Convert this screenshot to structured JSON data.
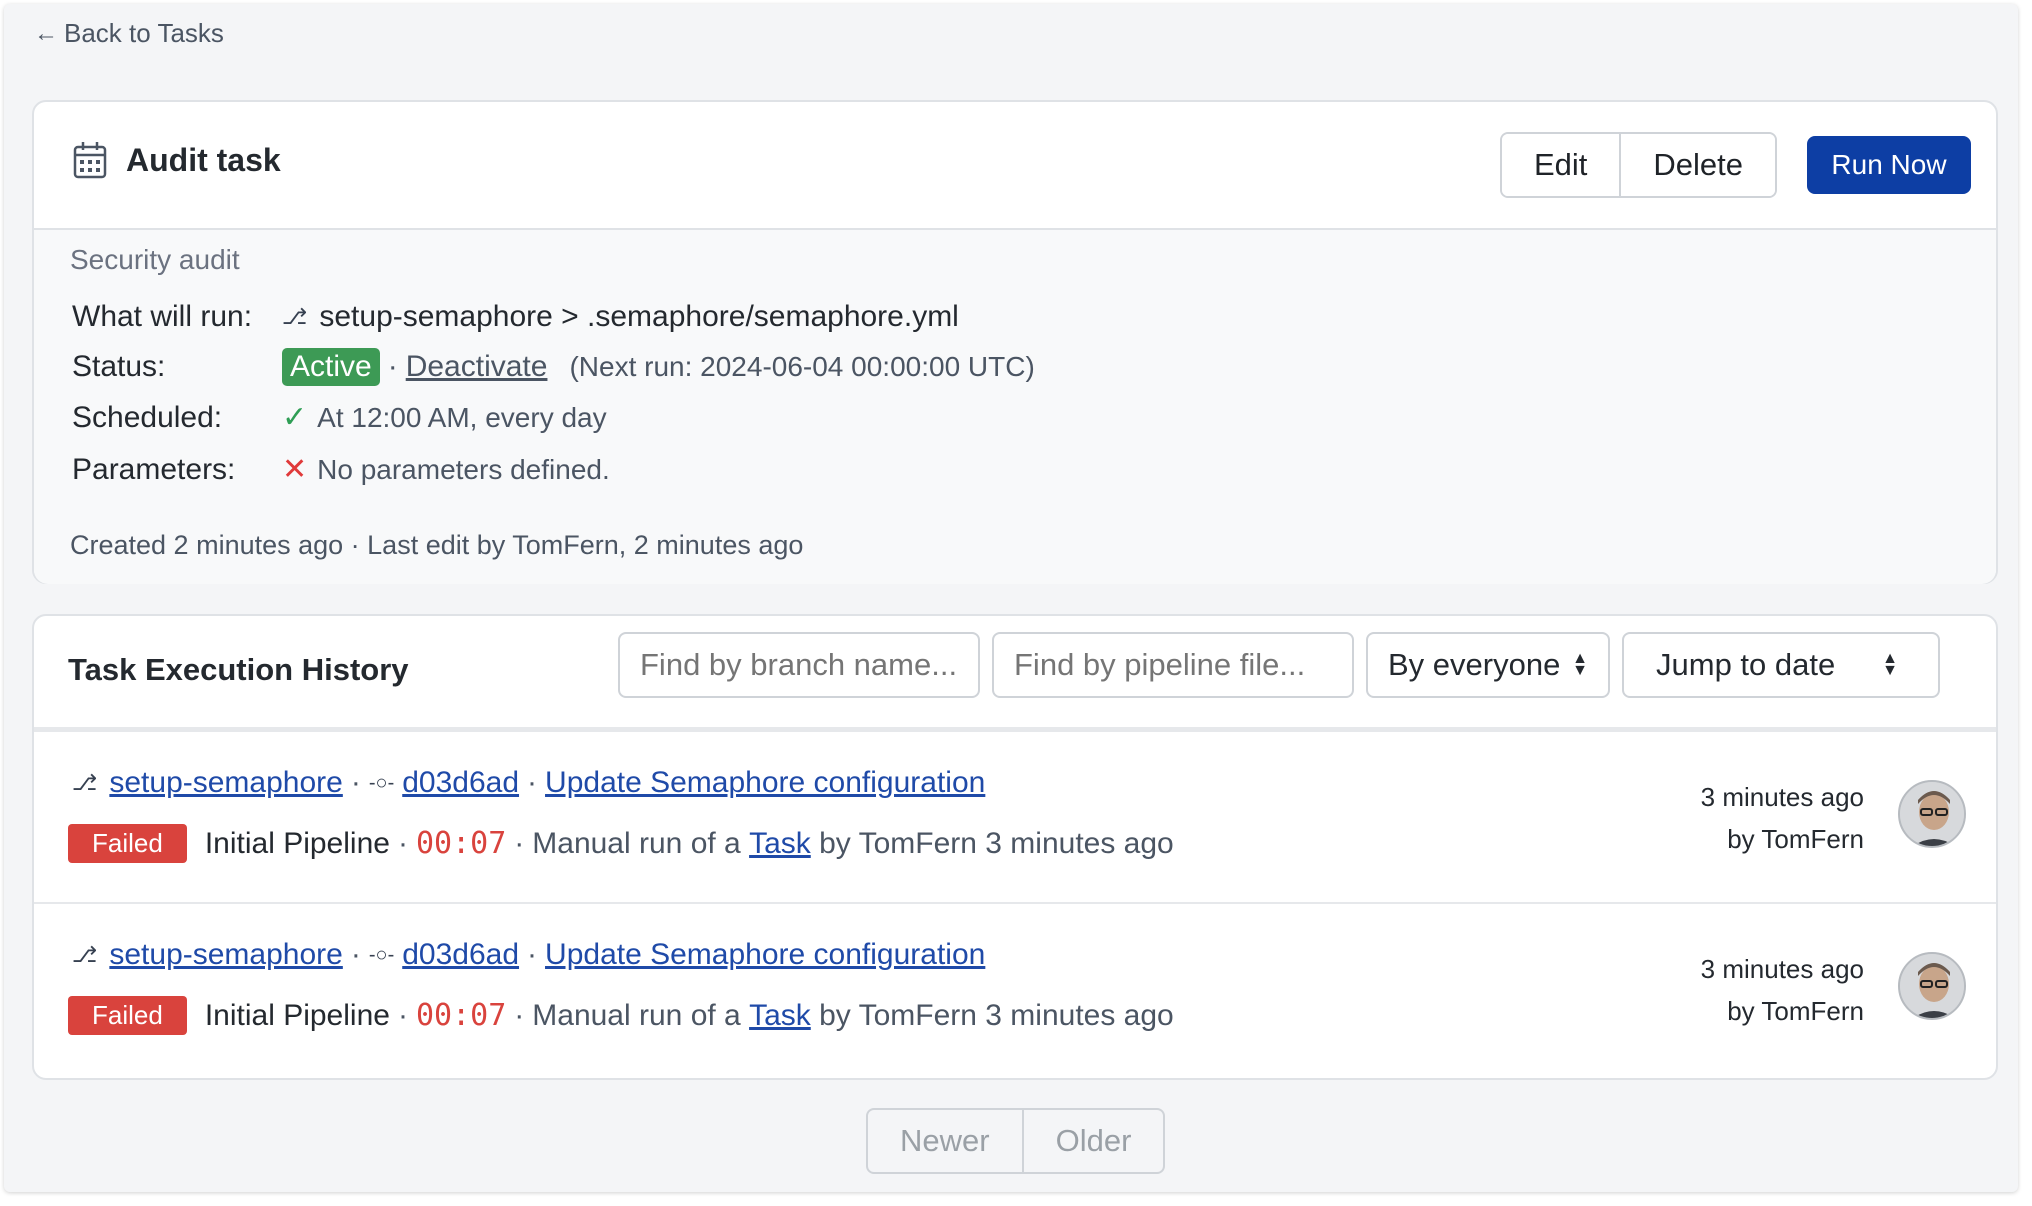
{
  "back_link": {
    "arrow": "←",
    "label": "Back to Tasks"
  },
  "task": {
    "title": "Audit task",
    "buttons": {
      "edit": "Edit",
      "delete": "Delete",
      "run_now": "Run Now"
    },
    "description": "Security audit",
    "what_will_run": {
      "label": "What will run:",
      "value": "setup-semaphore > .semaphore/semaphore.yml"
    },
    "status": {
      "label": "Status:",
      "badge": "Active",
      "separator": "·",
      "deactivate": "Deactivate",
      "next_run": "(Next run: 2024-06-04 00:00:00 UTC)"
    },
    "scheduled": {
      "label": "Scheduled:",
      "value": "At 12:00 AM, every day"
    },
    "parameters": {
      "label": "Parameters:",
      "value": "No parameters defined."
    },
    "created": "Created 2 minutes ago · Last edit by TomFern, 2 minutes ago"
  },
  "history": {
    "title": "Task Execution History",
    "filters": {
      "branch_placeholder": "Find by branch name...",
      "pipeline_placeholder": "Find by pipeline file...",
      "people": "By everyone",
      "date": "Jump to date"
    },
    "executions": [
      {
        "branch": "setup-semaphore",
        "commit": "d03d6ad",
        "message": "Update Semaphore configuration",
        "status": "Failed",
        "pipeline": "Initial Pipeline",
        "duration": "00:07",
        "trigger_prefix": "Manual run of a",
        "trigger_link": "Task",
        "trigger_suffix": "by TomFern 3 minutes ago",
        "when": "3 minutes ago",
        "by": "by TomFern"
      },
      {
        "branch": "setup-semaphore",
        "commit": "d03d6ad",
        "message": "Update Semaphore configuration",
        "status": "Failed",
        "pipeline": "Initial Pipeline",
        "duration": "00:07",
        "trigger_prefix": "Manual run of a",
        "trigger_link": "Task",
        "trigger_suffix": "by TomFern 3 minutes ago",
        "when": "3 minutes ago",
        "by": "by TomFern"
      }
    ]
  },
  "pager": {
    "newer": "Newer",
    "older": "Older"
  },
  "colors": {
    "primary": "#0d3ea4",
    "active": "#3d9a55",
    "failed": "#d9433d",
    "link": "#1f4aa8"
  }
}
